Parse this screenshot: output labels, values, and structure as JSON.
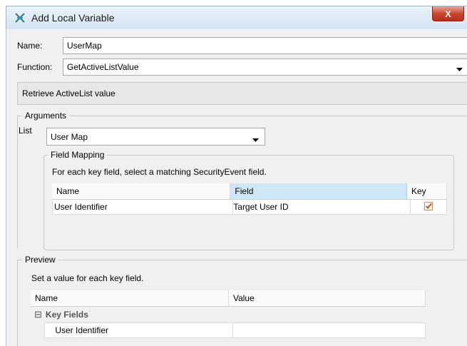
{
  "window": {
    "title": "Add Local Variable",
    "close_glyph": "X",
    "icon": "variable-icon"
  },
  "form": {
    "name_label": "Name:",
    "name_value": "UserMap",
    "function_label": "Function:",
    "function_value": "GetActiveListValue",
    "description": "Retrieve ActiveList value"
  },
  "arguments": {
    "legend": "Arguments",
    "list_label": "List",
    "list_value": "User Map",
    "field_mapping": {
      "legend": "Field Mapping",
      "instruction": "For each key field, select a matching SecurityEvent field.",
      "columns": [
        "Name",
        "Field",
        "Key"
      ],
      "rows": [
        {
          "name": "User Identifier",
          "field": "Target User ID",
          "key": true
        }
      ]
    }
  },
  "preview": {
    "legend": "Preview",
    "instruction": "Set a value for each key field.",
    "columns": [
      "Name",
      "Value"
    ],
    "group_label": "Key Fields",
    "group_toggle": "⊟",
    "rows": [
      {
        "name": "User Identifier",
        "value": ""
      }
    ]
  },
  "colors": {
    "selected_header": "#cfe6f5",
    "close_button": "#c7432c",
    "title_bar": "#d6e4f3"
  }
}
